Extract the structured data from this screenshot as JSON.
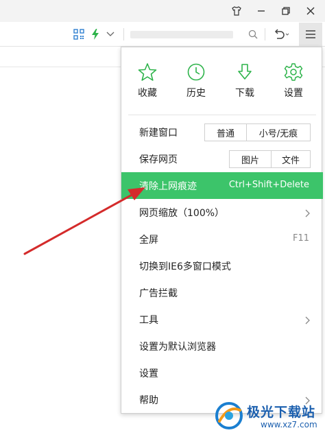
{
  "window_controls": [
    {
      "name": "skin-icon"
    },
    {
      "name": "minimize-icon"
    },
    {
      "name": "restore-icon"
    },
    {
      "name": "close-icon"
    }
  ],
  "accent_color": "#3cc46a",
  "annotation_color": "#d42b2b",
  "quick_actions": [
    {
      "label": "收藏",
      "icon": "star-icon"
    },
    {
      "label": "历史",
      "icon": "clock-icon"
    },
    {
      "label": "下载",
      "icon": "download-arrow-icon"
    },
    {
      "label": "设置",
      "icon": "gear-icon"
    }
  ],
  "menu": {
    "new_window": {
      "label": "新建窗口",
      "btn_normal": "普通",
      "btn_private": "小号/无痕"
    },
    "save_page": {
      "label": "保存网页",
      "btn_image": "图片",
      "btn_file": "文件"
    },
    "clear_history": {
      "label": "清除上网痕迹",
      "shortcut": "Ctrl+Shift+Delete"
    },
    "zoom": {
      "label": "网页缩放（100%）"
    },
    "fullscreen": {
      "label": "全屏",
      "shortcut": "F11"
    },
    "ie6_mode": {
      "label": "切换到IE6多窗口模式"
    },
    "adblock": {
      "label": "广告拦截"
    },
    "tools": {
      "label": "工具"
    },
    "default_browser": {
      "label": "设置为默认浏览器"
    },
    "settings": {
      "label": "设置"
    },
    "help": {
      "label": "帮助"
    }
  },
  "watermark": {
    "name": "极光下载站",
    "url": "www.xz7.com"
  }
}
